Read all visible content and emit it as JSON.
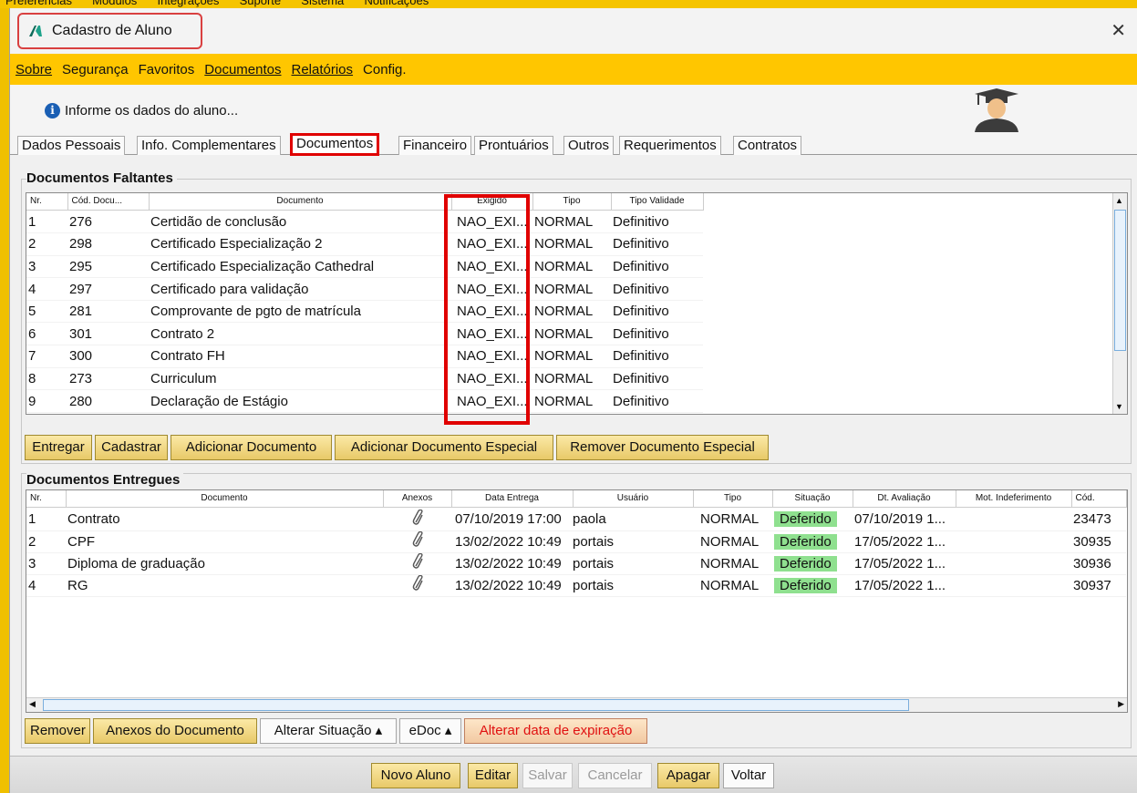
{
  "app_menu": [
    "Preferências",
    "Módulos",
    "Integrações",
    "Suporte",
    "Sistema",
    "Notificações"
  ],
  "window": {
    "title": "Cadastro de Aluno",
    "close": "✕"
  },
  "menu": [
    "Sobre",
    "Segurança",
    "Favoritos",
    "Documentos",
    "Relatórios",
    "Config."
  ],
  "info": "Informe os dados do aluno...",
  "tabs": [
    "Dados Pessoais",
    "Info. Complementares",
    "Documentos",
    "Financeiro",
    "Prontuários",
    "Outros",
    "Requerimentos",
    "Contratos"
  ],
  "faltantes": {
    "title": "Documentos Faltantes",
    "headers": [
      "Nr.",
      "Cód. Docu...",
      "Documento",
      "Exigido",
      "Tipo",
      "Tipo Validade"
    ],
    "rows": [
      [
        "1",
        "276",
        "Certidão de conclusão",
        "NAO_EXI...",
        "NORMAL",
        "Definitivo"
      ],
      [
        "2",
        "298",
        "Certificado Especialização 2",
        "NAO_EXI...",
        "NORMAL",
        "Definitivo"
      ],
      [
        "3",
        "295",
        "Certificado Especialização Cathedral",
        "NAO_EXI...",
        "NORMAL",
        "Definitivo"
      ],
      [
        "4",
        "297",
        "Certificado para validação",
        "NAO_EXI...",
        "NORMAL",
        "Definitivo"
      ],
      [
        "5",
        "281",
        "Comprovante de pgto de matrícula",
        "NAO_EXI...",
        "NORMAL",
        "Definitivo"
      ],
      [
        "6",
        "301",
        "Contrato 2",
        "NAO_EXI...",
        "NORMAL",
        "Definitivo"
      ],
      [
        "7",
        "300",
        "Contrato FH",
        "NAO_EXI...",
        "NORMAL",
        "Definitivo"
      ],
      [
        "8",
        "273",
        "Curriculum",
        "NAO_EXI...",
        "NORMAL",
        "Definitivo"
      ],
      [
        "9",
        "280",
        "Declaração de Estágio",
        "NAO_EXI...",
        "NORMAL",
        "Definitivo"
      ]
    ],
    "buttons": [
      "Entregar",
      "Cadastrar",
      "Adicionar Documento",
      "Adicionar Documento Especial",
      "Remover Documento Especial"
    ]
  },
  "entregues": {
    "title": "Documentos Entregues",
    "headers": [
      "Nr.",
      "Documento",
      "Anexos",
      "Data Entrega",
      "Usuário",
      "Tipo",
      "Situação",
      "Dt. Avaliação",
      "Mot. Indeferimento",
      "Cód."
    ],
    "rows": [
      [
        "1",
        "Contrato",
        "07/10/2019 17:00",
        "paola",
        "NORMAL",
        "Deferido",
        "07/10/2019 1...",
        "",
        "23473"
      ],
      [
        "2",
        "CPF",
        "13/02/2022 10:49",
        "portais",
        "NORMAL",
        "Deferido",
        "17/05/2022 1...",
        "",
        "30935"
      ],
      [
        "3",
        "Diploma de graduação",
        "13/02/2022 10:49",
        "portais",
        "NORMAL",
        "Deferido",
        "17/05/2022 1...",
        "",
        "30936"
      ],
      [
        "4",
        "RG",
        "13/02/2022 10:49",
        "portais",
        "NORMAL",
        "Deferido",
        "17/05/2022 1...",
        "",
        "30937"
      ]
    ],
    "buttons": [
      "Remover",
      "Anexos do Documento",
      "Alterar Situação ▴",
      "eDoc ▴",
      "Alterar data de expiração"
    ]
  },
  "footer_buttons": [
    "Novo Aluno",
    "Editar",
    "Salvar",
    "Cancelar",
    "Apagar",
    "Voltar"
  ],
  "colors": {
    "menu_bg": "#ffc600",
    "highlight": "#e00000",
    "deferido": "#8fe08f"
  }
}
